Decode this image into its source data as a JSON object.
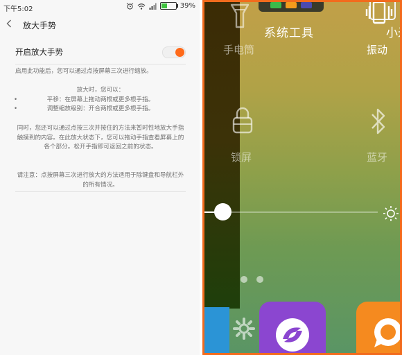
{
  "status_bar": {
    "time": "下午5:02",
    "battery_text": "39%",
    "battery_level": 0.39
  },
  "header": {
    "title": "放大手势"
  },
  "setting": {
    "label": "开启放大手势",
    "enabled": true,
    "accent_color": "#ff6a1a"
  },
  "description": {
    "intro": "启用此功能后，您可以通过点按屏幕三次进行缩放。",
    "zoom_heading": "放大时，您可以：",
    "bullets": [
      "平移：在屏幕上拖动两根或更多根手指。",
      "调整缩放级别：开合两根或更多根手指。"
    ],
    "hold_para": "同时，您还可以通过点按三次并按住的方法来暂时性地放大手指触摸到的内容。在此放大状态下，您可以拖动手指查看屏幕上的各个部分。松开手指即可返回之前的状态。",
    "note": "请注意：点按屏幕三次进行放大的方法适用于除键盘和导航栏外的所有情况。"
  },
  "magnified_view": {
    "section_title": "系统工具",
    "section_title_right": "小米",
    "tiles": [
      {
        "label": "手电筒",
        "icon": "flashlight-icon"
      },
      {
        "label": "振动",
        "icon": "vibrate-icon"
      },
      {
        "label": "锁屏",
        "icon": "lock-icon"
      },
      {
        "label": "蓝牙",
        "icon": "bluetooth-icon"
      }
    ],
    "brightness_level": 0.1,
    "page_indicator_count": 2,
    "border_color": "#f26b1d"
  }
}
